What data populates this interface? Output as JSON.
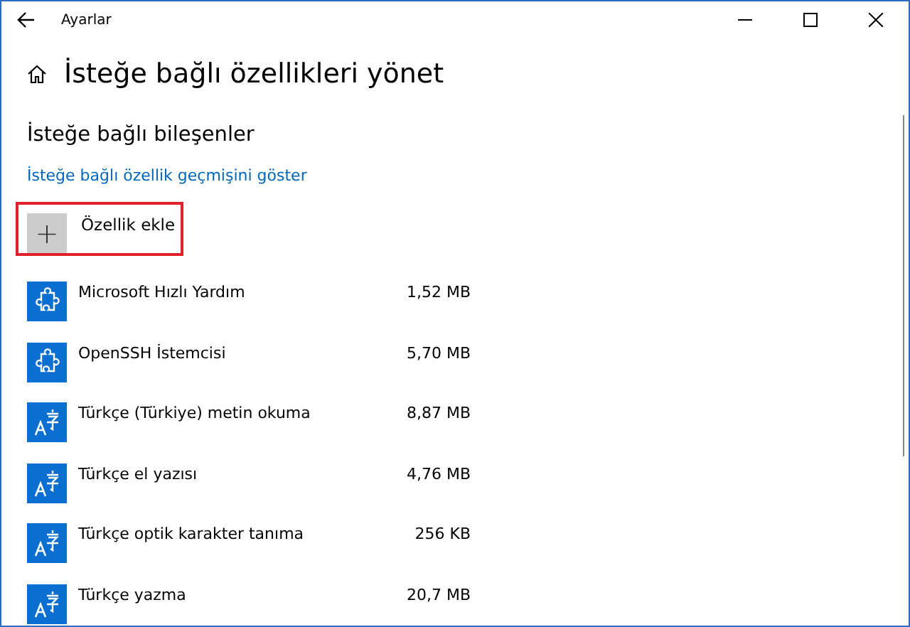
{
  "window": {
    "title": "Ayarlar"
  },
  "page_title": "İsteğe bağlı özellikleri yönet",
  "section_title": "İsteğe bağlı bileşenler",
  "history_link": "İsteğe bağlı özellik geçmişini göster",
  "add_button": {
    "icon": "+",
    "label": "Özellik ekle"
  },
  "features": [
    {
      "kind": "puzzle",
      "name": "Microsoft Hızlı Yardım",
      "size": "1,52 MB"
    },
    {
      "kind": "puzzle",
      "name": "OpenSSH İstemcisi",
      "size": "5,70 MB"
    },
    {
      "kind": "language",
      "name": "Türkçe (Türkiye) metin okuma",
      "size": "8,87 MB"
    },
    {
      "kind": "language",
      "name": "Türkçe el yazısı",
      "size": "4,76 MB"
    },
    {
      "kind": "language",
      "name": "Türkçe optik karakter tanıma",
      "size": "256 KB"
    },
    {
      "kind": "language",
      "name": "Türkçe yazma",
      "size": "20,7 MB"
    }
  ]
}
